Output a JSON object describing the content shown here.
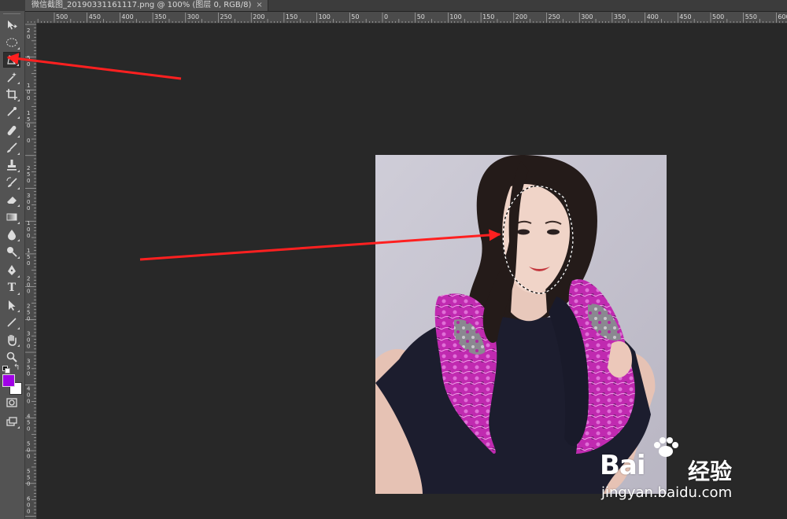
{
  "document_tab": {
    "title": "微信截图_20190331161117.png @ 100% (图层 0, RGB/8)",
    "close_glyph": "×"
  },
  "toolbar": {
    "tools": [
      {
        "name": "move-tool",
        "icon": "move-icon"
      },
      {
        "name": "elliptical-marquee-tool",
        "icon": "ellipse-marquee-icon"
      },
      {
        "name": "polygonal-lasso-tool",
        "icon": "polygonal-lasso-icon",
        "selected": true
      },
      {
        "name": "magic-wand-tool",
        "icon": "magic-wand-icon"
      },
      {
        "name": "crop-tool",
        "icon": "crop-icon"
      },
      {
        "name": "eyedropper-tool",
        "icon": "eyedropper-icon"
      },
      {
        "name": "healing-brush-tool",
        "icon": "bandage-icon"
      },
      {
        "name": "brush-tool",
        "icon": "brush-icon"
      },
      {
        "name": "clone-stamp-tool",
        "icon": "stamp-icon"
      },
      {
        "name": "history-brush-tool",
        "icon": "history-brush-icon"
      },
      {
        "name": "eraser-tool",
        "icon": "eraser-icon"
      },
      {
        "name": "gradient-tool",
        "icon": "gradient-icon"
      },
      {
        "name": "blur-tool",
        "icon": "droplet-icon"
      },
      {
        "name": "dodge-tool",
        "icon": "dodge-icon"
      },
      {
        "name": "pen-tool",
        "icon": "pen-icon"
      },
      {
        "name": "type-tool",
        "icon": "type-icon",
        "glyph": "T"
      },
      {
        "name": "path-selection-tool",
        "icon": "arrow-cursor-icon"
      },
      {
        "name": "line-tool",
        "icon": "line-icon"
      },
      {
        "name": "hand-tool",
        "icon": "hand-icon"
      },
      {
        "name": "zoom-tool",
        "icon": "magnifier-icon"
      }
    ],
    "foreground_color": "#a000e6",
    "background_color": "#ffffff",
    "swap_glyph": "↰"
  },
  "ruler_top": {
    "labels": [
      "500",
      "450",
      "400",
      "350",
      "300",
      "250",
      "200",
      "150",
      "100",
      "50",
      "0",
      "50",
      "100",
      "150",
      "200",
      "250",
      "300",
      "350",
      "400",
      "450",
      "500",
      "550",
      "600"
    ]
  },
  "ruler_left": {
    "labels": [
      "2 0",
      "5 0",
      "1 0 0",
      "1 5 0",
      "0",
      "2 5 0",
      "3 0 0",
      "1 0 0",
      "1 5 0",
      "2 0 0",
      "2 5 0",
      "3 0 0",
      "3 5 0",
      "4 0 0",
      "4 5 0",
      "5 0 0",
      "5 5 0",
      "6 0 0"
    ]
  },
  "annotations": {
    "arrow_color": "#ff2020"
  },
  "watermark": {
    "logo": "Bai",
    "logo_cn": "经验",
    "url": "jingyan.baidu.com"
  },
  "colors": {
    "workspace": "#282828",
    "toolbar": "#535353",
    "ruler": "#4b4b4b"
  }
}
